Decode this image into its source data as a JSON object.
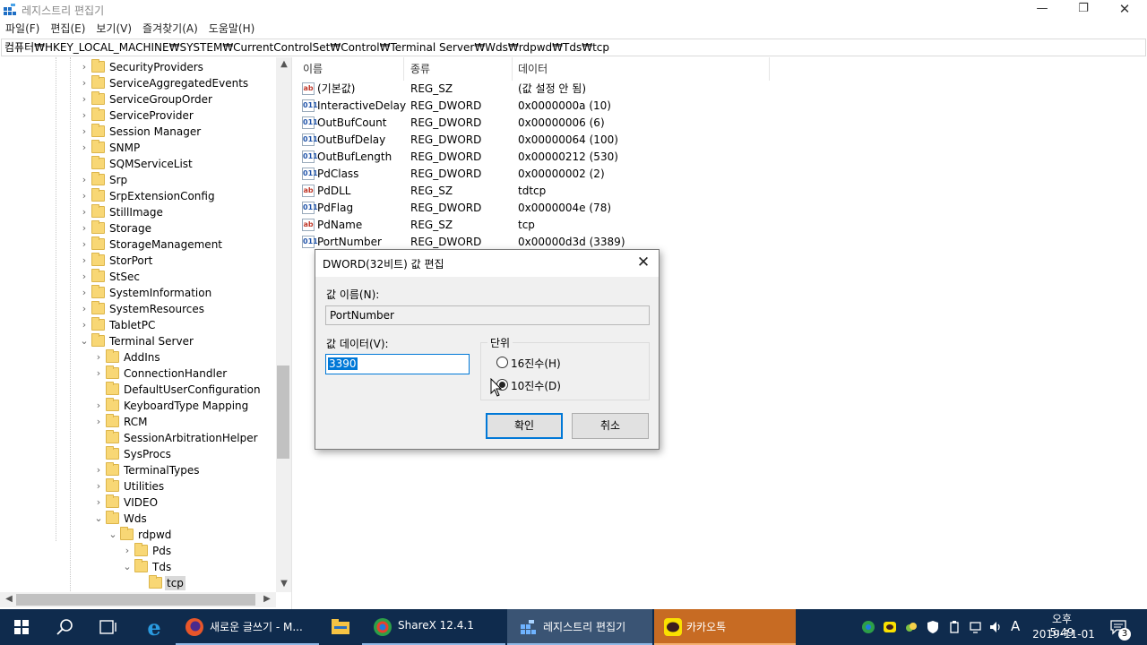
{
  "window": {
    "title": "레지스트리 편집기",
    "menu": [
      "파일(F)",
      "편집(E)",
      "보기(V)",
      "즐겨찾기(A)",
      "도움말(H)"
    ],
    "address": "컴퓨터₩HKEY_LOCAL_MACHINE₩SYSTEM₩CurrentControlSet₩Control₩Terminal Server₩Wds₩rdpwd₩Tds₩tcp"
  },
  "tree": {
    "items": [
      {
        "label": "SecurityProviders",
        "chevron": "›"
      },
      {
        "label": "ServiceAggregatedEvents",
        "chevron": "›"
      },
      {
        "label": "ServiceGroupOrder",
        "chevron": "›"
      },
      {
        "label": "ServiceProvider",
        "chevron": "›"
      },
      {
        "label": "Session Manager",
        "chevron": "›"
      },
      {
        "label": "SNMP",
        "chevron": "›"
      },
      {
        "label": "SQMServiceList",
        "chevron": ""
      },
      {
        "label": "Srp",
        "chevron": "›"
      },
      {
        "label": "SrpExtensionConfig",
        "chevron": "›"
      },
      {
        "label": "StillImage",
        "chevron": "›"
      },
      {
        "label": "Storage",
        "chevron": "›"
      },
      {
        "label": "StorageManagement",
        "chevron": "›"
      },
      {
        "label": "StorPort",
        "chevron": "›"
      },
      {
        "label": "StSec",
        "chevron": "›"
      },
      {
        "label": "SystemInformation",
        "chevron": "›"
      },
      {
        "label": "SystemResources",
        "chevron": "›"
      },
      {
        "label": "TabletPC",
        "chevron": "›"
      },
      {
        "label": "Terminal Server",
        "chevron": "⌄"
      },
      {
        "label": "AddIns",
        "chevron": "›"
      },
      {
        "label": "ConnectionHandler",
        "chevron": "›"
      },
      {
        "label": "DefaultUserConfiguration",
        "chevron": ""
      },
      {
        "label": "KeyboardType Mapping",
        "chevron": "›"
      },
      {
        "label": "RCM",
        "chevron": "›"
      },
      {
        "label": "SessionArbitrationHelper",
        "chevron": ""
      },
      {
        "label": "SysProcs",
        "chevron": ""
      },
      {
        "label": "TerminalTypes",
        "chevron": "›"
      },
      {
        "label": "Utilities",
        "chevron": "›"
      },
      {
        "label": "VIDEO",
        "chevron": "›"
      },
      {
        "label": "Wds",
        "chevron": "⌄"
      },
      {
        "label": "rdpwd",
        "chevron": "⌄"
      },
      {
        "label": "Pds",
        "chevron": "›"
      },
      {
        "label": "Tds",
        "chevron": "⌄"
      },
      {
        "label": "tcp",
        "chevron": ""
      }
    ]
  },
  "list": {
    "columns": [
      "이름",
      "종류",
      "데이터"
    ],
    "rows": [
      {
        "icon": "ab",
        "name": "(기본값)",
        "type": "REG_SZ",
        "data": "(값 설정 안 됨)"
      },
      {
        "icon": "011",
        "name": "InteractiveDelay",
        "type": "REG_DWORD",
        "data": "0x0000000a (10)"
      },
      {
        "icon": "011",
        "name": "OutBufCount",
        "type": "REG_DWORD",
        "data": "0x00000006 (6)"
      },
      {
        "icon": "011",
        "name": "OutBufDelay",
        "type": "REG_DWORD",
        "data": "0x00000064 (100)"
      },
      {
        "icon": "011",
        "name": "OutBufLength",
        "type": "REG_DWORD",
        "data": "0x00000212 (530)"
      },
      {
        "icon": "011",
        "name": "PdClass",
        "type": "REG_DWORD",
        "data": "0x00000002 (2)"
      },
      {
        "icon": "ab",
        "name": "PdDLL",
        "type": "REG_SZ",
        "data": "tdtcp"
      },
      {
        "icon": "011",
        "name": "PdFlag",
        "type": "REG_DWORD",
        "data": "0x0000004e (78)"
      },
      {
        "icon": "ab",
        "name": "PdName",
        "type": "REG_SZ",
        "data": "tcp"
      },
      {
        "icon": "011",
        "name": "PortNumber",
        "type": "REG_DWORD",
        "data": "0x00000d3d (3389)"
      }
    ]
  },
  "dialog": {
    "title": "DWORD(32비트) 값 편집",
    "close_symbol": "✕",
    "name_label": "값 이름(N):",
    "name_value": "PortNumber",
    "data_label": "값 데이터(V):",
    "data_value": "3390",
    "unit_label": "단위",
    "radio_hex": "16진수(H)",
    "radio_dec": "10진수(D)",
    "selected_unit": "decimal",
    "ok": "확인",
    "cancel": "취소"
  },
  "taskbar": {
    "apps": [
      {
        "label": "새로운 글쓰기 - M...",
        "icon": "firefox-icon"
      },
      {
        "label": "ShareX 12.4.1",
        "icon": "sharex-icon"
      },
      {
        "label": "레지스트리 편집기",
        "icon": "regedit-icon"
      },
      {
        "label": "카카오톡",
        "icon": "kakaotalk-icon"
      }
    ],
    "time": "오후 5:49",
    "date": "2019-11-01",
    "ime": "A",
    "notification_count": "3"
  }
}
